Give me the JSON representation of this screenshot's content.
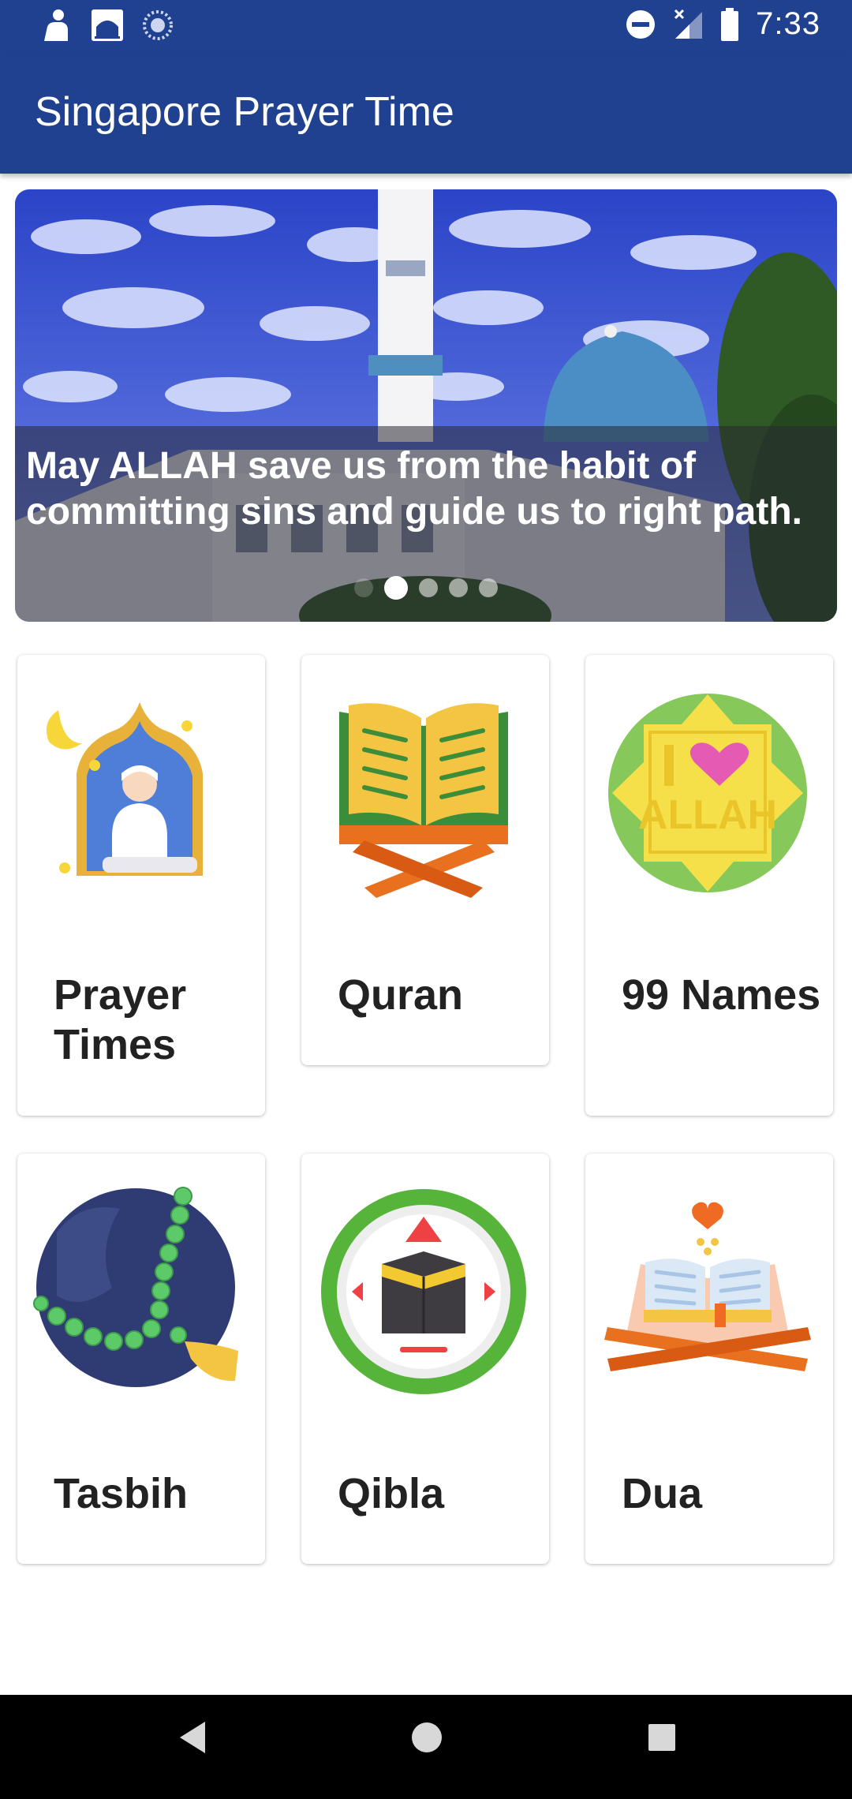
{
  "status_bar": {
    "time": "7:33",
    "icons": [
      "person-icon",
      "mosque-icon",
      "sync-icon",
      "dnd-icon",
      "signal-icon",
      "battery-icon"
    ]
  },
  "app_bar": {
    "title": "Singapore Prayer Time"
  },
  "banner": {
    "caption": "May ALLAH save us from the habit of committing sins and guide us to right path.",
    "slide_count": 5,
    "active_slide": 2
  },
  "cards": [
    {
      "label": "Prayer Times",
      "icon": "prayer-icon"
    },
    {
      "label": "Quran",
      "icon": "quran-icon"
    },
    {
      "label": "99 Names",
      "icon": "allah-names-icon"
    },
    {
      "label": "Tasbih",
      "icon": "tasbih-icon"
    },
    {
      "label": "Qibla",
      "icon": "qibla-compass-icon"
    },
    {
      "label": "Dua",
      "icon": "dua-book-icon"
    }
  ],
  "nav_bar": {
    "buttons": [
      "back-icon",
      "home-icon",
      "recents-icon"
    ]
  },
  "colors": {
    "primary": "#1f418f",
    "nav": "#000000"
  }
}
